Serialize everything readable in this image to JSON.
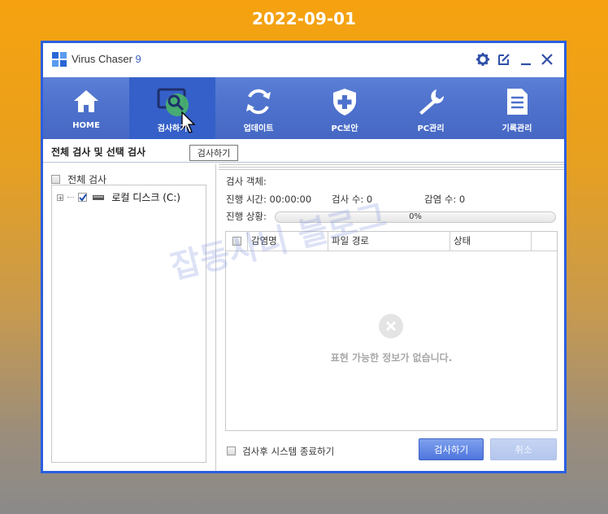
{
  "date_caption": "2022-09-01",
  "app": {
    "title": "Virus Chaser",
    "version": "9"
  },
  "toolbar": [
    {
      "label": "HOME",
      "icon": "home-icon"
    },
    {
      "label": "검사하기",
      "icon": "scan-monitor-icon"
    },
    {
      "label": "업데이트",
      "icon": "refresh-icon"
    },
    {
      "label": "PC보안",
      "icon": "shield-plus-icon"
    },
    {
      "label": "PC관리",
      "icon": "wrench-icon"
    },
    {
      "label": "기록관리",
      "icon": "document-icon"
    }
  ],
  "tooltip": "검사하기",
  "section_title": "전체 검사 및 선택 검사",
  "left": {
    "full_scan_label": "전체 검사",
    "tree_item_label": "로컬 디스크 (C:)"
  },
  "info": {
    "target_label": "검사 객체:",
    "elapsed_label": "진행 시간: 00:00:00",
    "scan_count_label": "검사 수: 0",
    "infected_count_label": "감염 수: 0",
    "progress_label": "진행 상황:",
    "progress_value": "0%",
    "progress_fraction": 0
  },
  "table": {
    "columns": [
      "감염명",
      "파일 경로",
      "상태"
    ],
    "empty_message": "표현 가능한 정보가 없습니다."
  },
  "bottom": {
    "shutdown_label": "검사후 시스템 종료하기",
    "scan_button": "검사하기",
    "cancel_button": "취소"
  },
  "watermark": "잡동사니 블로그",
  "colors": {
    "accent": "#4d71cc",
    "window_border": "#2a5fe0",
    "active_tool": "#3560c9"
  }
}
